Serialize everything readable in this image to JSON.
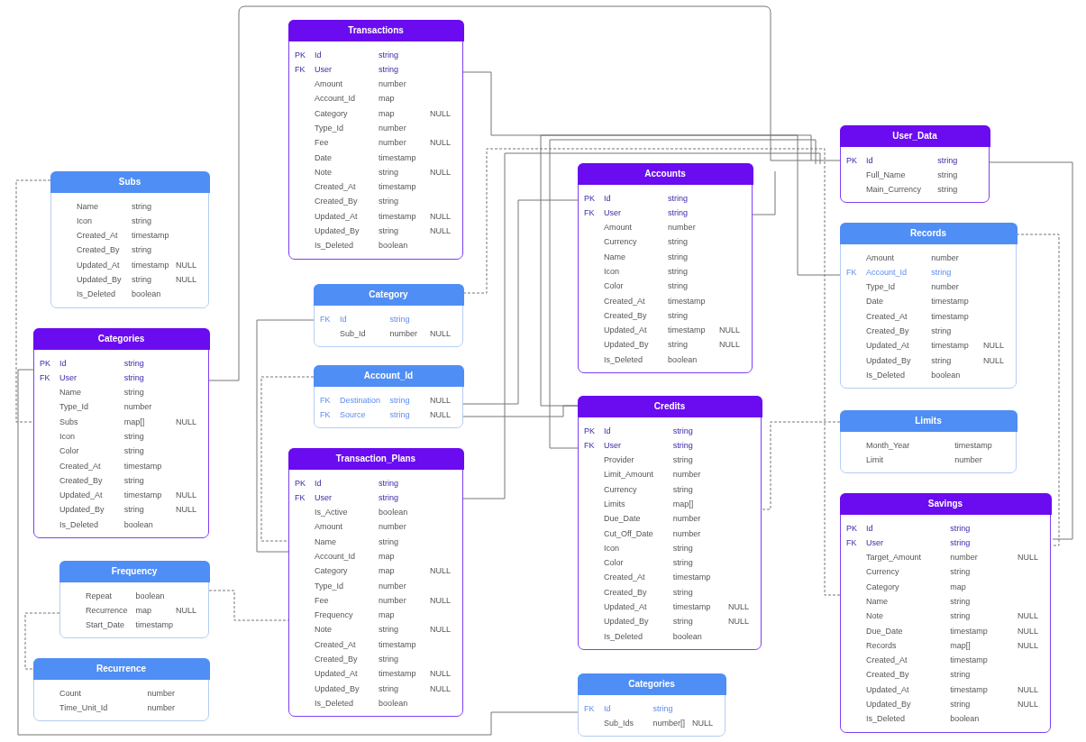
{
  "tables": [
    {
      "title": "Transactions",
      "kind": "main",
      "rows": [
        {
          "key": "PK",
          "name": "Id",
          "type": "string"
        },
        {
          "key": "FK",
          "name": "User",
          "type": "string"
        },
        {
          "name": "Amount",
          "type": "number"
        },
        {
          "name": "Account_Id",
          "type": "map"
        },
        {
          "name": "Category",
          "type": "map",
          "null": "NULL"
        },
        {
          "name": "Type_Id",
          "type": "number"
        },
        {
          "name": "Fee",
          "type": "number",
          "null": "NULL"
        },
        {
          "name": "Date",
          "type": "timestamp"
        },
        {
          "name": "Note",
          "type": "string",
          "null": "NULL"
        },
        {
          "name": "Created_At",
          "type": "timestamp"
        },
        {
          "name": "Created_By",
          "type": "string"
        },
        {
          "name": "Updated_At",
          "type": "timestamp",
          "null": "NULL"
        },
        {
          "name": "Updated_By",
          "type": "string",
          "null": "NULL"
        },
        {
          "name": "Is_Deleted",
          "type": "boolean"
        }
      ]
    },
    {
      "title": "Subs",
      "kind": "embedded",
      "rows": [
        {
          "name": "Name",
          "type": "string"
        },
        {
          "name": "Icon",
          "type": "string"
        },
        {
          "name": "Created_At",
          "type": "timestamp"
        },
        {
          "name": "Created_By",
          "type": "string"
        },
        {
          "name": "Updated_At",
          "type": "timestamp",
          "null": "NULL"
        },
        {
          "name": "Updated_By",
          "type": "string",
          "null": "NULL"
        },
        {
          "name": "Is_Deleted",
          "type": "boolean"
        }
      ]
    },
    {
      "title": "Categories",
      "kind": "main",
      "rows": [
        {
          "key": "PK",
          "name": "Id",
          "type": "string"
        },
        {
          "key": "FK",
          "name": "User",
          "type": "string"
        },
        {
          "name": "Name",
          "type": "string"
        },
        {
          "name": "Type_Id",
          "type": "number"
        },
        {
          "name": "Subs",
          "type": "map[]",
          "null": "NULL"
        },
        {
          "name": "Icon",
          "type": "string"
        },
        {
          "name": "Color",
          "type": "string"
        },
        {
          "name": "Created_At",
          "type": "timestamp"
        },
        {
          "name": "Created_By",
          "type": "string"
        },
        {
          "name": "Updated_At",
          "type": "timestamp",
          "null": "NULL"
        },
        {
          "name": "Updated_By",
          "type": "string",
          "null": "NULL"
        },
        {
          "name": "Is_Deleted",
          "type": "boolean"
        }
      ]
    },
    {
      "title": "Category",
      "kind": "embedded",
      "rows": [
        {
          "key": "FK",
          "name": "Id",
          "type": "string"
        },
        {
          "name": "Sub_Id",
          "type": "number",
          "null": "NULL"
        }
      ]
    },
    {
      "title": "Account_Id",
      "kind": "embedded",
      "rows": [
        {
          "key": "FK",
          "name": "Destination",
          "type": "string",
          "null": "NULL"
        },
        {
          "key": "FK",
          "name": "Source",
          "type": "string",
          "null": "NULL"
        }
      ]
    },
    {
      "title": "Transaction_Plans",
      "kind": "main",
      "rows": [
        {
          "key": "PK",
          "name": "Id",
          "type": "string"
        },
        {
          "key": "FK",
          "name": "User",
          "type": "string"
        },
        {
          "name": "Is_Active",
          "type": "boolean"
        },
        {
          "name": "Amount",
          "type": "number"
        },
        {
          "name": "Name",
          "type": "string"
        },
        {
          "name": "Account_Id",
          "type": "map"
        },
        {
          "name": "Category",
          "type": "map",
          "null": "NULL"
        },
        {
          "name": "Type_Id",
          "type": "number"
        },
        {
          "name": "Fee",
          "type": "number",
          "null": "NULL"
        },
        {
          "name": "Frequency",
          "type": "map"
        },
        {
          "name": "Note",
          "type": "string",
          "null": "NULL"
        },
        {
          "name": "Created_At",
          "type": "timestamp"
        },
        {
          "name": "Created_By",
          "type": "string"
        },
        {
          "name": "Updated_At",
          "type": "timestamp",
          "null": "NULL"
        },
        {
          "name": "Updated_By",
          "type": "string",
          "null": "NULL"
        },
        {
          "name": "Is_Deleted",
          "type": "boolean"
        }
      ]
    },
    {
      "title": "Frequency",
      "kind": "embedded",
      "rows": [
        {
          "name": "Repeat",
          "type": "boolean"
        },
        {
          "name": "Recurrence",
          "type": "map",
          "null": "NULL"
        },
        {
          "name": "Start_Date",
          "type": "timestamp"
        }
      ]
    },
    {
      "title": "Recurrence",
      "kind": "embedded",
      "rows": [
        {
          "name": "Count",
          "type": "number"
        },
        {
          "name": "Time_Unit_Id",
          "type": "number"
        }
      ]
    },
    {
      "title": "Accounts",
      "kind": "main",
      "rows": [
        {
          "key": "PK",
          "name": "Id",
          "type": "string"
        },
        {
          "key": "FK",
          "name": "User",
          "type": "string"
        },
        {
          "name": "Amount",
          "type": "number"
        },
        {
          "name": "Currency",
          "type": "string"
        },
        {
          "name": "Name",
          "type": "string"
        },
        {
          "name": "Icon",
          "type": "string"
        },
        {
          "name": "Color",
          "type": "string"
        },
        {
          "name": "Created_At",
          "type": "timestamp"
        },
        {
          "name": "Created_By",
          "type": "string"
        },
        {
          "name": "Updated_At",
          "type": "timestamp",
          "null": "NULL"
        },
        {
          "name": "Updated_By",
          "type": "string",
          "null": "NULL"
        },
        {
          "name": "Is_Deleted",
          "type": "boolean"
        }
      ]
    },
    {
      "title": "Credits",
      "kind": "main",
      "rows": [
        {
          "key": "PK",
          "name": "Id",
          "type": "string"
        },
        {
          "key": "FK",
          "name": "User",
          "type": "string"
        },
        {
          "name": "Provider",
          "type": "string"
        },
        {
          "name": "Limit_Amount",
          "type": "number"
        },
        {
          "name": "Currency",
          "type": "string"
        },
        {
          "name": "Limits",
          "type": "map[]"
        },
        {
          "name": "Due_Date",
          "type": "number"
        },
        {
          "name": "Cut_Off_Date",
          "type": "number"
        },
        {
          "name": "Icon",
          "type": "string"
        },
        {
          "name": "Color",
          "type": "string"
        },
        {
          "name": "Created_At",
          "type": "timestamp"
        },
        {
          "name": "Created_By",
          "type": "string"
        },
        {
          "name": "Updated_At",
          "type": "timestamp",
          "null": "NULL"
        },
        {
          "name": "Updated_By",
          "type": "string",
          "null": "NULL"
        },
        {
          "name": "Is_Deleted",
          "type": "boolean"
        }
      ]
    },
    {
      "title": "Categories",
      "kind": "embedded",
      "rows": [
        {
          "key": "FK",
          "name": "Id",
          "type": "string"
        },
        {
          "name": "Sub_Ids",
          "type": "number[]",
          "null": "NULL"
        }
      ]
    },
    {
      "title": "User_Data",
      "kind": "main",
      "rows": [
        {
          "key": "PK",
          "name": "Id",
          "type": "string"
        },
        {
          "name": "Full_Name",
          "type": "string"
        },
        {
          "name": "Main_Currency",
          "type": "string"
        }
      ]
    },
    {
      "title": "Records",
      "kind": "embedded",
      "rows": [
        {
          "name": "Amount",
          "type": "number"
        },
        {
          "key": "FK",
          "name": "Account_Id",
          "type": "string"
        },
        {
          "name": "Type_Id",
          "type": "number"
        },
        {
          "name": "Date",
          "type": "timestamp"
        },
        {
          "name": "Created_At",
          "type": "timestamp"
        },
        {
          "name": "Created_By",
          "type": "string"
        },
        {
          "name": "Updated_At",
          "type": "timestamp",
          "null": "NULL"
        },
        {
          "name": "Updated_By",
          "type": "string",
          "null": "NULL"
        },
        {
          "name": "Is_Deleted",
          "type": "boolean"
        }
      ]
    },
    {
      "title": "Limits",
      "kind": "embedded",
      "rows": [
        {
          "name": "Month_Year",
          "type": "timestamp"
        },
        {
          "name": "Limit",
          "type": "number"
        }
      ]
    },
    {
      "title": "Savings",
      "kind": "main",
      "rows": [
        {
          "key": "PK",
          "name": "Id",
          "type": "string"
        },
        {
          "key": "FK",
          "name": "User",
          "type": "string"
        },
        {
          "name": "Target_Amount",
          "type": "number",
          "null": "NULL"
        },
        {
          "name": "Currency",
          "type": "string"
        },
        {
          "name": "Category",
          "type": "map"
        },
        {
          "name": "Name",
          "type": "string"
        },
        {
          "name": "Note",
          "type": "string",
          "null": "NULL"
        },
        {
          "name": "Due_Date",
          "type": "timestamp",
          "null": "NULL"
        },
        {
          "name": "Records",
          "type": "map[]",
          "null": "NULL"
        },
        {
          "name": "Created_At",
          "type": "timestamp"
        },
        {
          "name": "Created_By",
          "type": "string"
        },
        {
          "name": "Updated_At",
          "type": "timestamp",
          "null": "NULL"
        },
        {
          "name": "Updated_By",
          "type": "string",
          "null": "NULL"
        },
        {
          "name": "Is_Deleted",
          "type": "boolean"
        }
      ]
    }
  ]
}
